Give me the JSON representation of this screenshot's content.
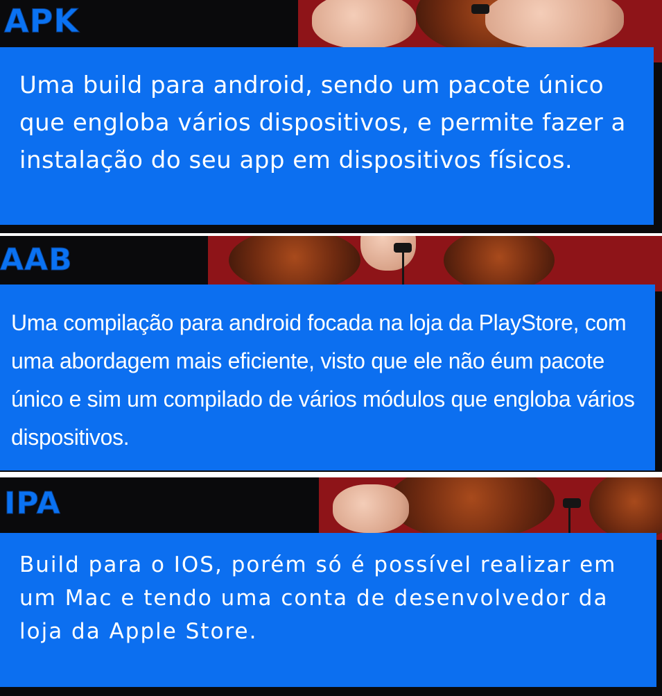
{
  "sections": [
    {
      "heading": "APK",
      "text": "Uma build para android, sendo um pacote único que engloba vários dispositivos, e permite fazer a instalação do seu app em dispositivos físicos."
    },
    {
      "heading": "AAB",
      "text": "Uma compilação para android focada na loja da PlayStore, com uma abordagem mais eficiente, visto que ele não éum pacote único e sim um compilado de vários módulos que engloba vários dispositivos."
    },
    {
      "heading": "IPA",
      "text": "Build para o IOS, porém só é possível realizar em um Mac e tendo uma conta de desenvolvedor da loja da Apple Store."
    }
  ],
  "colors": {
    "card_blue": "#0c6ff0",
    "heading_blue": "#0a72f2",
    "background_dark": "#0a0a0c",
    "shirt_red": "#8e1418",
    "text": "#ffffff"
  }
}
